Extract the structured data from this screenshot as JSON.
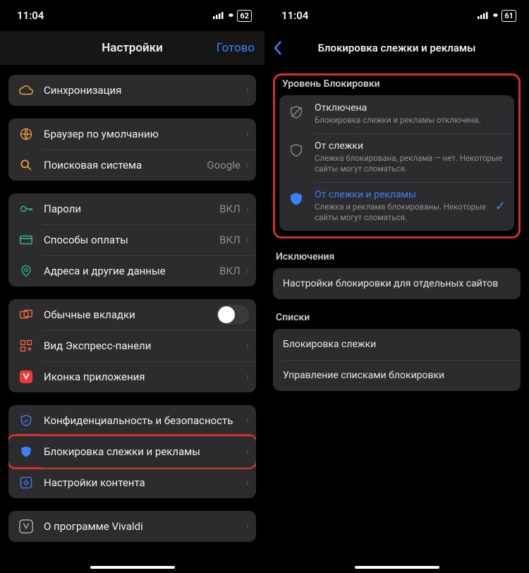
{
  "status": {
    "time": "11:04",
    "battery_left": "62",
    "battery_right": "61"
  },
  "screen1": {
    "title": "Настройки",
    "done": "Готово",
    "groups": [
      {
        "rows": [
          {
            "icon": "cloud",
            "color": "#f2a33c",
            "label": "Синхронизация"
          }
        ]
      },
      {
        "rows": [
          {
            "icon": "globe",
            "color": "#f2a33c",
            "label": "Браузер по умолчанию"
          },
          {
            "icon": "search",
            "color": "#f2a33c",
            "label": "Поисковая система",
            "value": "Google"
          }
        ]
      },
      {
        "rows": [
          {
            "icon": "key",
            "color": "#2fb89a",
            "label": "Пароли",
            "value": "ВКЛ"
          },
          {
            "icon": "creditcard",
            "color": "#2fb89a",
            "label": "Способы оплаты",
            "value": "ВКЛ"
          },
          {
            "icon": "pin",
            "color": "#2fb89a",
            "label": "Адреса и другие данные",
            "value": "ВКЛ"
          }
        ]
      },
      {
        "rows": [
          {
            "icon": "tabs",
            "color": "#f0663c",
            "label": "Обычные вкладки",
            "toggle": true
          },
          {
            "icon": "grid",
            "color": "#f0663c",
            "label": "Вид Экспресс-панели"
          },
          {
            "icon": "vivaldi",
            "color": "#ef3939",
            "label": "Иконка приложения"
          }
        ]
      },
      {
        "rows": [
          {
            "icon": "shield-check",
            "color": "#3a82f7",
            "label": "Конфиденциальность и безопасность"
          },
          {
            "icon": "shield-fill",
            "color": "#3a82f7",
            "label": "Блокировка слежки и рекламы",
            "highlighted": true
          },
          {
            "icon": "gear-box",
            "color": "#3a82f7",
            "label": "Настройки контента"
          }
        ]
      },
      {
        "rows": [
          {
            "icon": "vivaldi-outline",
            "color": "#aaa",
            "label": "О программе Vivaldi"
          }
        ]
      }
    ]
  },
  "screen2": {
    "title": "Блокировка слежки и рекламы",
    "section_level": "Уровень Блокировки",
    "options": [
      {
        "title": "Отключена",
        "desc": "Блокировка слежки и рекламы отключена.",
        "icon": "shield-off"
      },
      {
        "title": "От слежки",
        "desc": "Слежка блокирована, реклама — нет. Некоторые сайты могут сломаться.",
        "icon": "shield-outline"
      },
      {
        "title": "От слежки и рекламы",
        "desc": "Слежка и реклама блокированы. Некоторые сайты могут сломаться.",
        "icon": "shield-fill",
        "selected": true
      }
    ],
    "section_exceptions": "Исключения",
    "exceptions_row": "Настройки блокировки для отдельных сайтов",
    "section_lists": "Списки",
    "lists": [
      "Блокировка слежки",
      "Управление списками блокировки"
    ]
  }
}
